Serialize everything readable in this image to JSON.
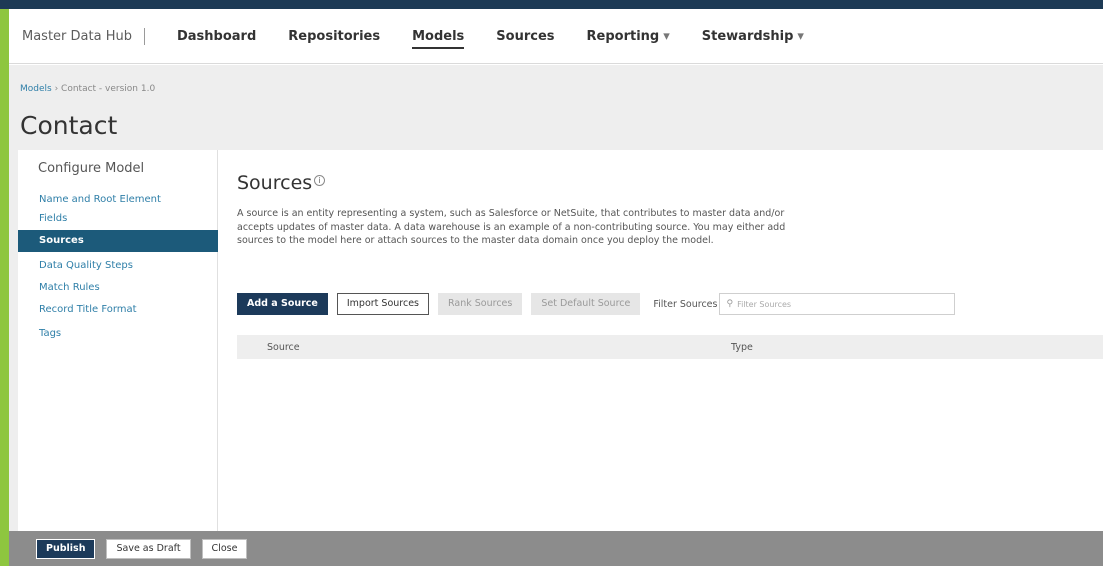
{
  "app": {
    "brand": "Master Data Hub"
  },
  "nav": {
    "items": [
      {
        "label": "Dashboard"
      },
      {
        "label": "Repositories"
      },
      {
        "label": "Models"
      },
      {
        "label": "Sources"
      },
      {
        "label": "Reporting"
      },
      {
        "label": "Stewardship"
      }
    ],
    "active": "Models"
  },
  "breadcrumb": {
    "link": "Models",
    "separator": " › ",
    "current": "Contact - version 1.0"
  },
  "page": {
    "title": "Contact"
  },
  "sidebar": {
    "title": "Configure Model",
    "items": [
      {
        "label": "Name and Root Element"
      },
      {
        "label": "Fields"
      },
      {
        "label": "Sources"
      },
      {
        "label": "Data Quality Steps"
      },
      {
        "label": "Match Rules"
      },
      {
        "label": "Record Title Format"
      },
      {
        "label": "Tags"
      }
    ],
    "active": "Sources"
  },
  "main": {
    "section_title": "Sources",
    "info_icon": "info-icon",
    "description": "A source is an entity representing a system, such as Salesforce or NetSuite, that contributes to master data and/or accepts updates of master data. A data warehouse is an example of a non-contributing source. You may either add sources to the model here or attach sources to the master data domain once you deploy the model.",
    "toolbar": {
      "add_source": "Add a Source",
      "import_sources": "Import Sources",
      "rank_sources": "Rank Sources",
      "set_default_source": "Set Default Source",
      "filter_label": "Filter Sources",
      "filter_placeholder": "Filter Sources"
    },
    "table": {
      "columns": [
        "Source",
        "Type"
      ],
      "rows": []
    }
  },
  "footer": {
    "publish": "Publish",
    "save_draft": "Save as Draft",
    "close": "Close"
  },
  "colors": {
    "top_strip": "#1d3a55",
    "accent_bar": "#8ec63f",
    "active_sidebar": "#1c5a7a",
    "primary_button": "#1c3a5a",
    "link": "#2f7fa8",
    "footer_bg": "#8c8c8c"
  }
}
